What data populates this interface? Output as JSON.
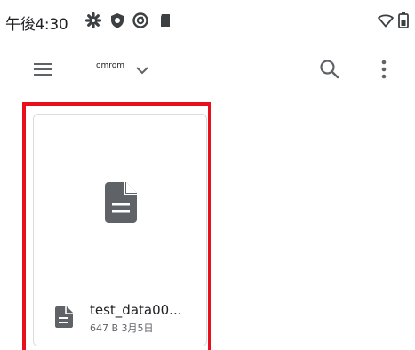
{
  "status_bar": {
    "time": "午後4:30",
    "icons": [
      "settings-gear-icon",
      "shield-icon",
      "sync-icon",
      "sd-card-icon",
      "wifi-icon",
      "battery-icon"
    ]
  },
  "app_bar": {
    "menu_icon": "hamburger-menu-icon",
    "root_title": "omrom",
    "dropdown_icon": "chevron-down-icon",
    "search_icon": "search-icon",
    "more_icon": "more-vert-icon"
  },
  "files": [
    {
      "name": "test_data00...",
      "meta": "647 B 3月5日",
      "icon": "document-icon"
    }
  ],
  "colors": {
    "highlight": "#e8101d",
    "icon": "#5f6368",
    "text_primary": "#202124",
    "text_secondary": "#5f6368"
  }
}
